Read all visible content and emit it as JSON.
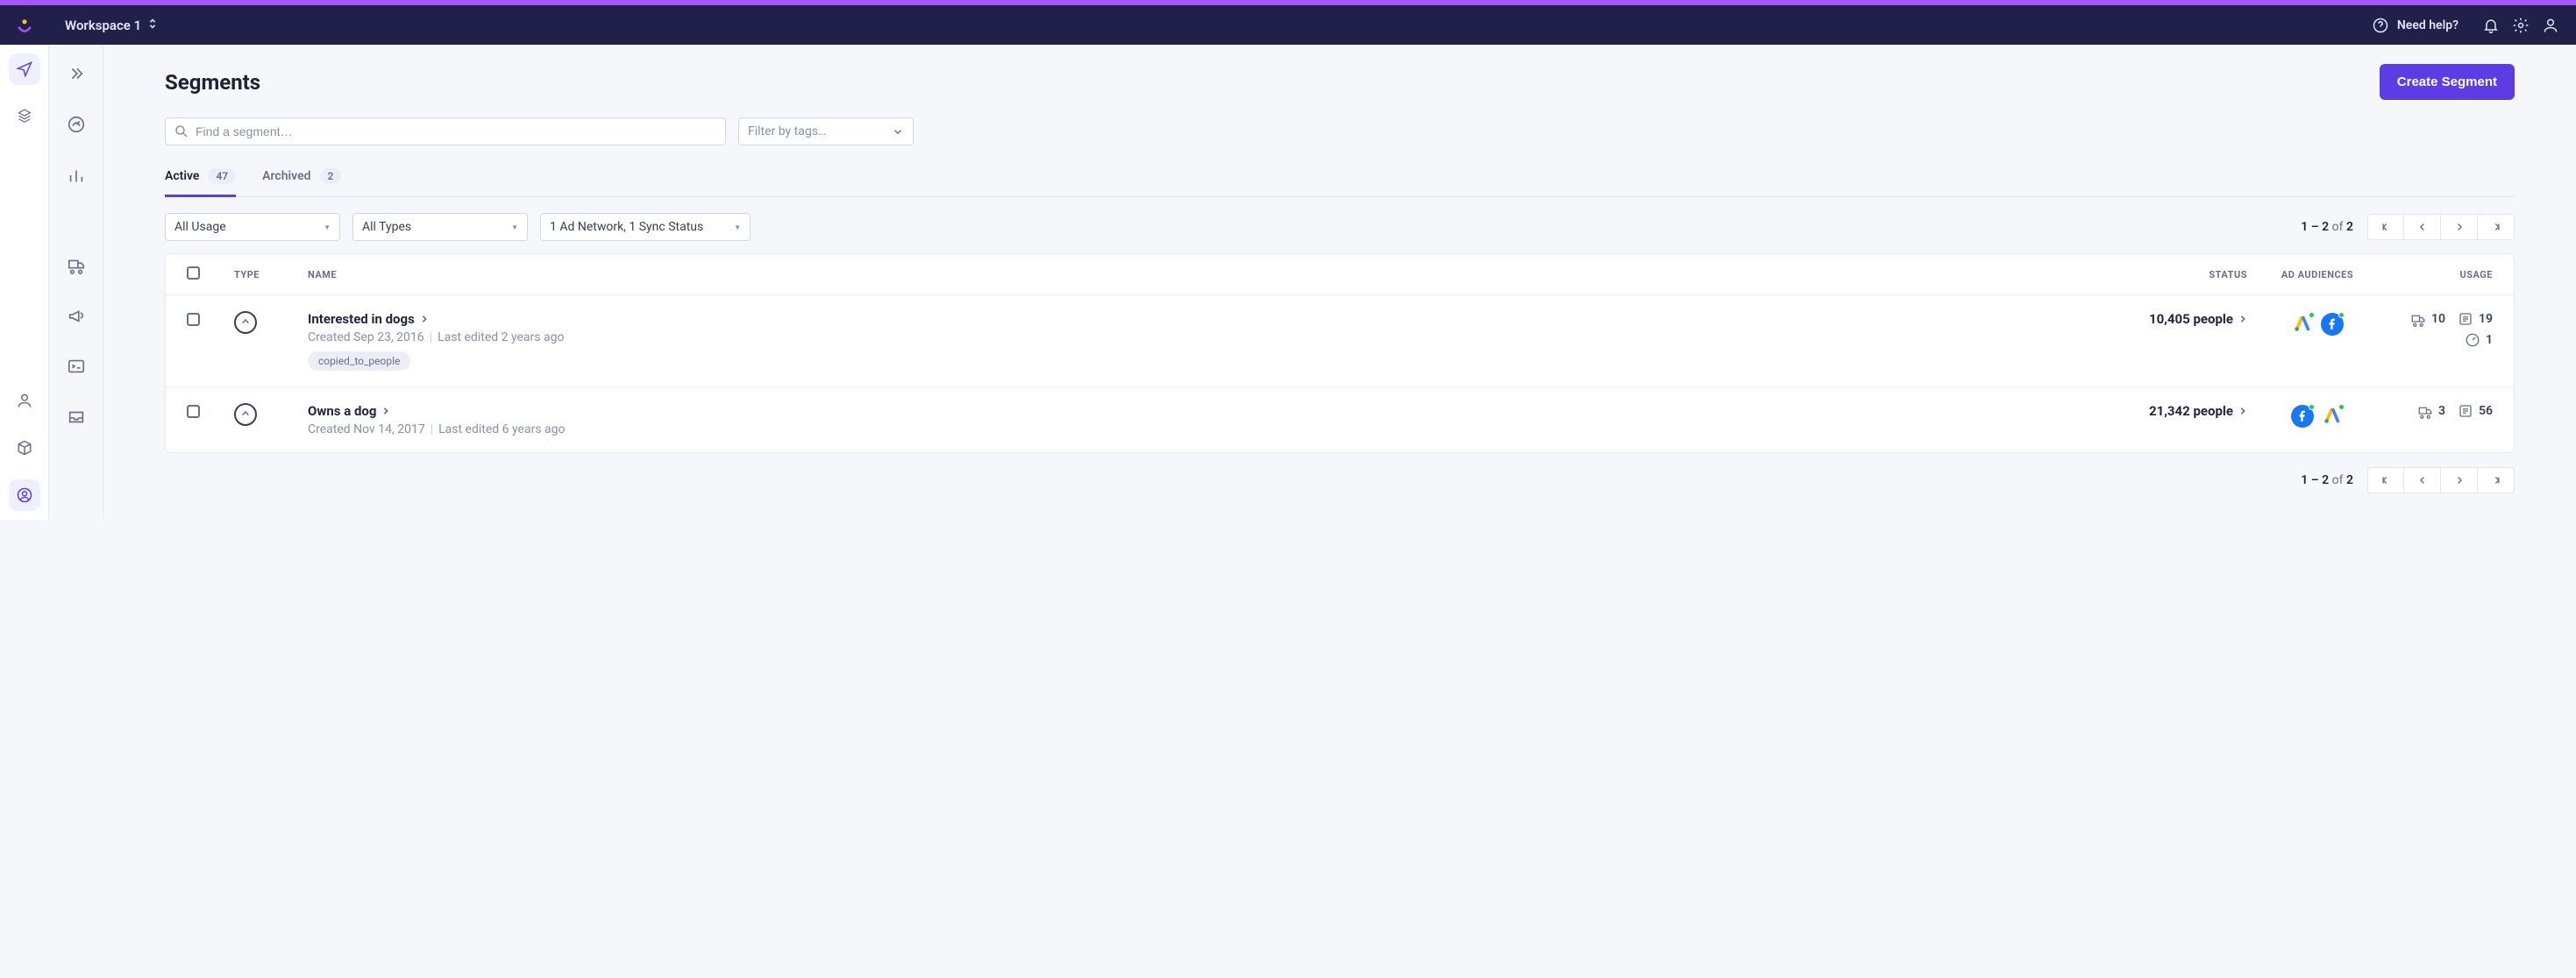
{
  "header": {
    "workspace": "Workspace 1",
    "help_label": "Need help?"
  },
  "page": {
    "title": "Segments",
    "create_button": "Create Segment"
  },
  "search": {
    "placeholder": "Find a segment…"
  },
  "tags_filter": {
    "placeholder": "Filter by tags…"
  },
  "tabs": {
    "active": {
      "label": "Active",
      "count": "47"
    },
    "archived": {
      "label": "Archived",
      "count": "2"
    }
  },
  "filters": {
    "usage": "All Usage",
    "types": "All Types",
    "adnetwork": "1 Ad Network, 1 Sync Status"
  },
  "pagination": {
    "range": "1 – 2",
    "of_label": "of",
    "total": "2"
  },
  "columns": {
    "type": "TYPE",
    "name": "NAME",
    "status": "STATUS",
    "audiences": "AD AUDIENCES",
    "usage": "USAGE"
  },
  "rows": [
    {
      "name": "Interested in dogs",
      "created": "Created Sep 23, 2016",
      "edited": "Last edited 2 years ago",
      "tag": "copied_to_people",
      "status": "10,405 people",
      "ad_order": [
        "google",
        "facebook"
      ],
      "usage_campaigns": "10",
      "usage_lists": "19",
      "usage_dash": "1"
    },
    {
      "name": "Owns a dog",
      "created": "Created Nov 14, 2017",
      "edited": "Last edited 6 years ago",
      "tag": null,
      "status": "21,342 people",
      "ad_order": [
        "facebook",
        "google"
      ],
      "usage_campaigns": "3",
      "usage_lists": "56",
      "usage_dash": null
    }
  ]
}
